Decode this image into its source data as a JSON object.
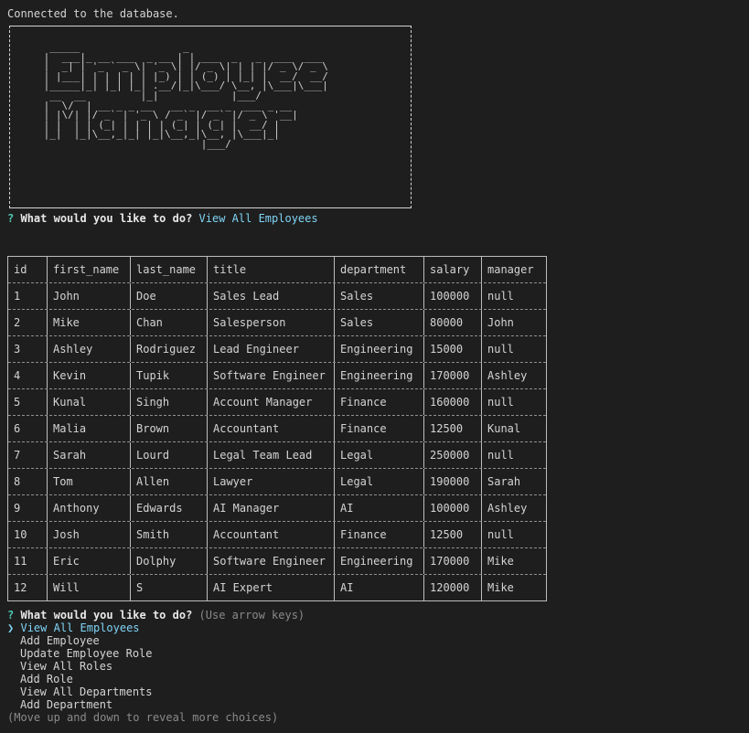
{
  "status_line": "Connected to the database.",
  "banner_art": "  _____                 _                       \n |  ___|_ __ ___  _ __ | | ___  _   _  ___  ___  \n |  _| | '_ ` _ \\| '_ \\| |/ _ \\| | | |/ _ \\/ _ \\ \n | |___| | | | | | |_) | | (_) | |_| |  __/  __/ \n |_____|_| |_| |_| .__/|_|\\___/ \\__, |\\___|\\___| \n  __  __         |_|            |___/            \n |  \\/  | __ _ _ __   __ _  __ _  ___ _ __       \n | |\\/| |/ _` | '_ \\ / _` |/ _` |/ _ \\ '__|      \n | |  | | (_| | | | | (_| | (_| |  __/ |         \n |_|  |_|\\__,_|_| |_|\\__,_|\\__, |\\___|_|         \n                           |___/                 ",
  "prompt1": {
    "mark": "?",
    "question": "What would you like to do?",
    "answer": "View All Employees"
  },
  "table": {
    "columns": [
      "id",
      "first_name",
      "last_name",
      "title",
      "department",
      "salary",
      "manager"
    ],
    "rows": [
      [
        "1",
        "John",
        "Doe",
        "Sales Lead",
        "Sales",
        "100000",
        "null"
      ],
      [
        "2",
        "Mike",
        "Chan",
        "Salesperson",
        "Sales",
        "80000",
        "John"
      ],
      [
        "3",
        "Ashley",
        "Rodriguez",
        "Lead Engineer",
        "Engineering",
        "15000",
        "null"
      ],
      [
        "4",
        "Kevin",
        "Tupik",
        "Software Engineer",
        "Engineering",
        "170000",
        "Ashley"
      ],
      [
        "5",
        "Kunal",
        "Singh",
        "Account Manager",
        "Finance",
        "160000",
        "null"
      ],
      [
        "6",
        "Malia",
        "Brown",
        "Accountant",
        "Finance",
        "12500",
        "Kunal"
      ],
      [
        "7",
        "Sarah",
        "Lourd",
        "Legal Team Lead",
        "Legal",
        "250000",
        "null"
      ],
      [
        "8",
        "Tom",
        "Allen",
        "Lawyer",
        "Legal",
        "190000",
        "Sarah"
      ],
      [
        "9",
        "Anthony",
        "Edwards",
        "AI Manager",
        "AI",
        "100000",
        "Ashley"
      ],
      [
        "10",
        "Josh",
        "Smith",
        "Accountant",
        "Finance",
        "12500",
        "null"
      ],
      [
        "11",
        "Eric",
        "Dolphy",
        "Software Engineer",
        "Engineering",
        "170000",
        "Mike"
      ],
      [
        "12",
        "Will",
        "S",
        "AI Expert",
        "AI",
        "120000",
        "Mike"
      ]
    ]
  },
  "prompt2": {
    "mark": "?",
    "question": "What would you like to do?",
    "hint": "(Use arrow keys)",
    "pointer": "❯",
    "choices": [
      "View All Employees",
      "Add Employee",
      "Update Employee Role",
      "View All Roles",
      "Add Role",
      "View All Departments",
      "Add Department"
    ],
    "footer": "(Move up and down to reveal more choices)"
  }
}
